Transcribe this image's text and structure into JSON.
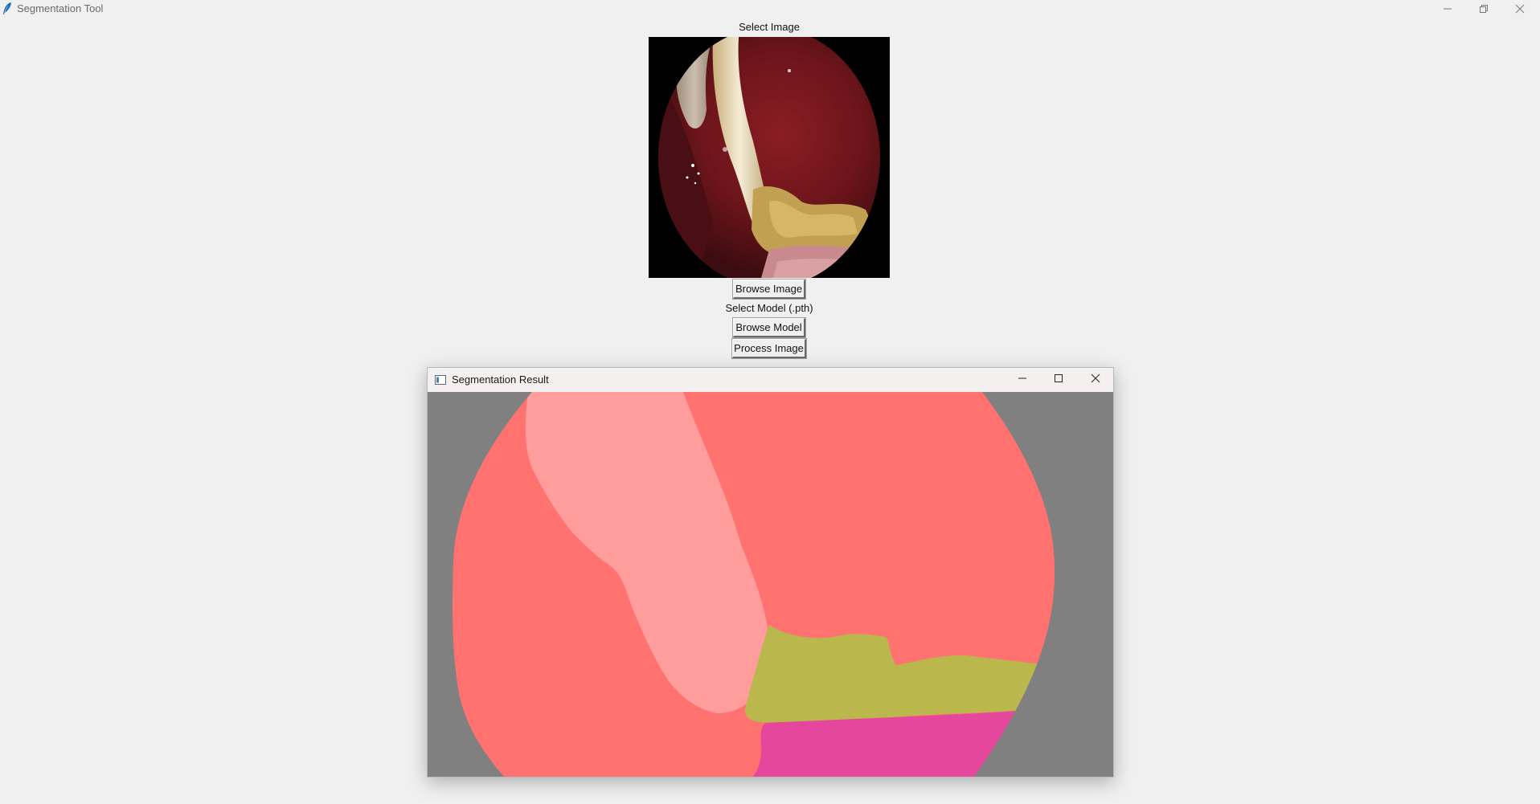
{
  "main_window": {
    "title": "Segmentation Tool",
    "controls": {
      "minimize_icon": "minimize-icon",
      "maximize_icon": "restore-icon",
      "close_icon": "close-icon"
    }
  },
  "form": {
    "select_image_label": "Select Image",
    "browse_image_button": "Browse Image",
    "select_model_label": "Select Model (.pth)",
    "browse_model_button": "Browse Model",
    "process_image_button": "Process Image"
  },
  "result_window": {
    "title": "Segmentation Result",
    "controls": {
      "minimize_icon": "minimize-icon",
      "maximize_icon": "maximize-icon",
      "close_icon": "close-icon"
    }
  },
  "colors": {
    "window_background": "#f0f0f0",
    "segment_background": "#808080",
    "segment_tissue": "#ff7270",
    "segment_instrument": "#ff9c9c",
    "segment_fat": "#bab84d",
    "segment_organ": "#e5479c"
  }
}
